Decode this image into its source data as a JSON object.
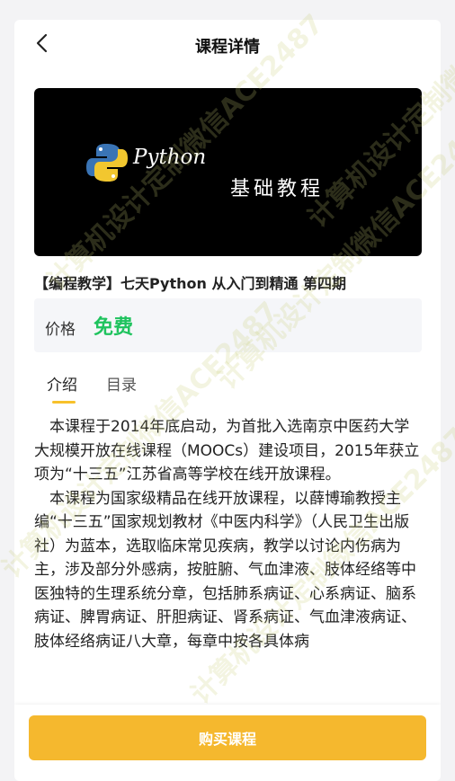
{
  "header": {
    "title": "课程详情"
  },
  "banner": {
    "english_text": "Python",
    "chinese_text": "基础教程"
  },
  "course": {
    "title": "【编程教学】七天Python 从入门到精通 第四期",
    "price_label": "价格",
    "price_value": "免费"
  },
  "tabs": [
    {
      "label": "介绍",
      "active": true
    },
    {
      "label": "目录",
      "active": false
    }
  ],
  "intro": {
    "paragraphs": [
      "本课程于2014年底启动，为首批入选南京中医药大学大规模开放在线课程（MOOCs）建设项目，2015年获立项为“十三五”江苏省高等学校在线开放课程。",
      "本课程为国家级精品在线开放课程，以薛博瑜教授主编“十三五”国家规划教材《中医内科学》（人民卫生出版社）为蓝本，选取临床常见疾病，教学以讨论内伤病为主，涉及部分外感病，按脏腑、气血津液、肢体经络等中医独特的生理系统分章，包括肺系病证、心系病证、脑系病证、脾胃病证、肝胆病证、肾系病证、气血津液病证、肢体经络病证八大章，每章中按各具体病"
    ]
  },
  "footer": {
    "buy_label": "购买课程"
  },
  "watermark": {
    "text": "计算机设计定制微信ACE2487"
  },
  "colors": {
    "accent": "#f5b82e",
    "price_green": "#1fc35e",
    "tab_indicator": "#f7c12b",
    "banner_bg": "#000000"
  },
  "icons": {
    "back": "chevron-left-icon",
    "logo": "python-logo-icon"
  }
}
